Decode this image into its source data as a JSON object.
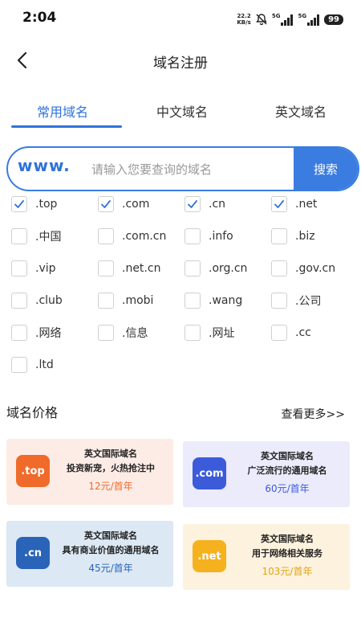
{
  "status_bar": {
    "time": "2:04",
    "net_speed_value": "22.2",
    "net_speed_unit": "KB/s",
    "sim1_label": "5G",
    "sim2_label": "5G",
    "battery": "99"
  },
  "header": {
    "title": "域名注册"
  },
  "tabs": [
    {
      "label": "常用域名",
      "active": true
    },
    {
      "label": "中文域名",
      "active": false
    },
    {
      "label": "英文域名",
      "active": false
    }
  ],
  "search": {
    "prefix": "www.",
    "placeholder": "请输入您要查询的域名",
    "button_label": "搜索"
  },
  "suffixes": [
    {
      "label": ".top",
      "checked": true
    },
    {
      "label": ".com",
      "checked": true
    },
    {
      "label": ".cn",
      "checked": true
    },
    {
      "label": ".net",
      "checked": true
    },
    {
      "label": ".中国",
      "checked": false
    },
    {
      "label": ".com.cn",
      "checked": false
    },
    {
      "label": ".info",
      "checked": false
    },
    {
      "label": ".biz",
      "checked": false
    },
    {
      "label": ".vip",
      "checked": false
    },
    {
      "label": ".net.cn",
      "checked": false
    },
    {
      "label": ".org.cn",
      "checked": false
    },
    {
      "label": ".gov.cn",
      "checked": false
    },
    {
      "label": ".club",
      "checked": false
    },
    {
      "label": ".mobi",
      "checked": false
    },
    {
      "label": ".wang",
      "checked": false
    },
    {
      "label": ".公司",
      "checked": false
    },
    {
      "label": ".网络",
      "checked": false
    },
    {
      "label": ".信息",
      "checked": false
    },
    {
      "label": ".网址",
      "checked": false
    },
    {
      "label": ".cc",
      "checked": false
    },
    {
      "label": ".ltd",
      "checked": false
    }
  ],
  "price_section": {
    "title": "域名价格",
    "more_label": "查看更多>>"
  },
  "price_cards": [
    {
      "logo": ".top",
      "title": "英文国际域名",
      "desc": "投资新宠，火热抢注中",
      "price": "12元/首年",
      "bg": "#fdece6",
      "logo_bg": "#f06a2a",
      "price_color": "#f06a2a"
    },
    {
      "logo": ".com",
      "title": "英文国际域名",
      "desc": "广泛流行的通用域名",
      "price": "60元/首年",
      "bg": "#ecebfb",
      "logo_bg": "#3b5bdb",
      "price_color": "#3b5bdb"
    },
    {
      "logo": ".cn",
      "title": "英文国际域名",
      "desc": "具有商业价值的通用域名",
      "price": "45元/首年",
      "bg": "#dce8f3",
      "logo_bg": "#2a64b8",
      "price_color": "#2a64b8"
    },
    {
      "logo": ".net",
      "title": "英文国际域名",
      "desc": "用于网络相关服务",
      "price": "103元/首年",
      "bg": "#fdf2dd",
      "logo_bg": "#f5b21e",
      "price_color": "#e0a414"
    }
  ],
  "colors": {
    "accent": "#2f73d9"
  }
}
